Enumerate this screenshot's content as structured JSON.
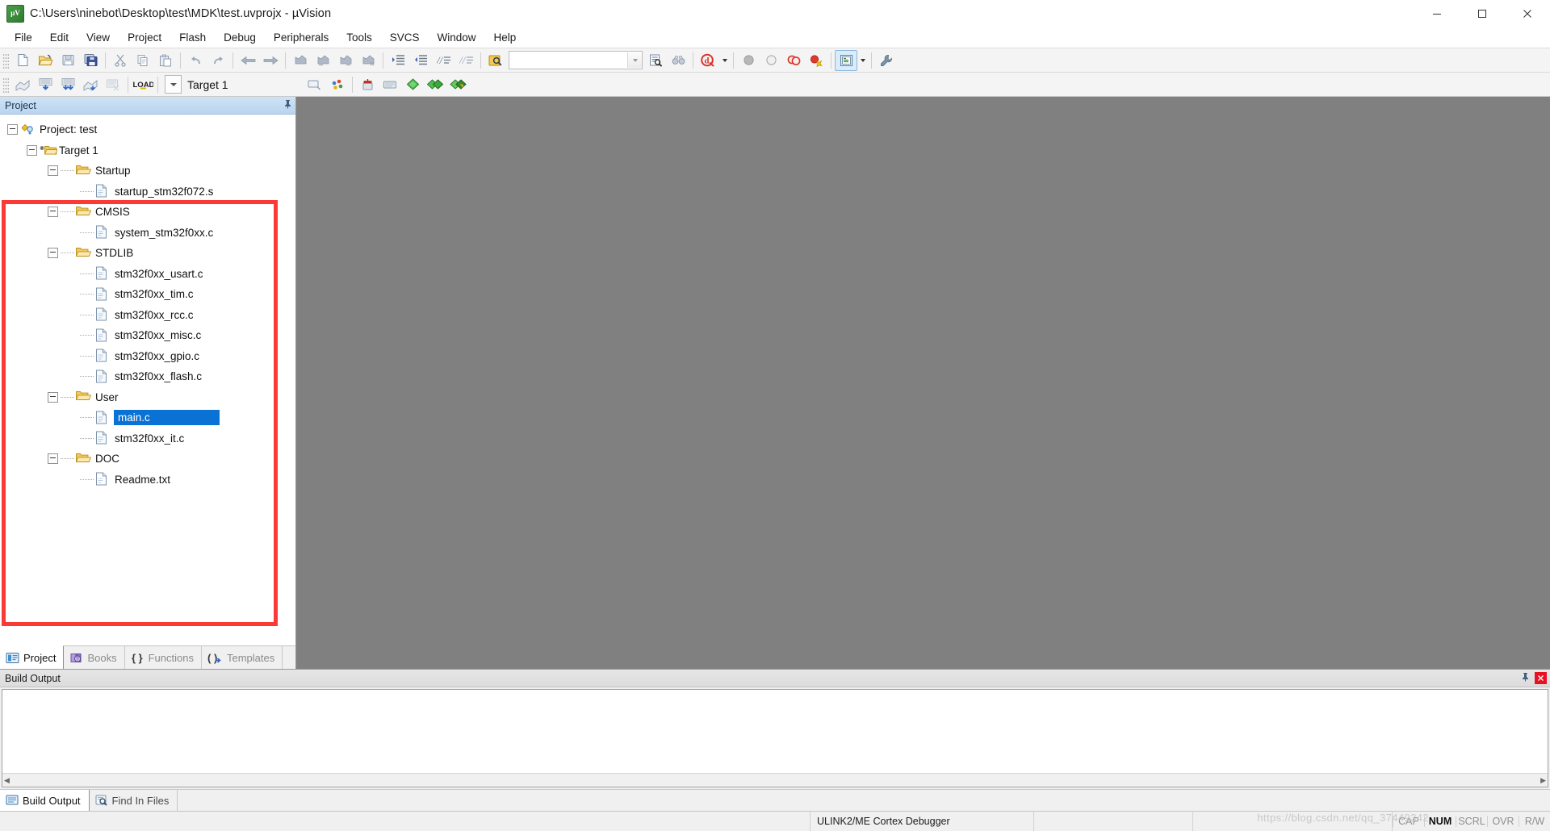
{
  "window": {
    "title": "C:\\Users\\ninebot\\Desktop\\test\\MDK\\test.uvprojx - µVision",
    "app_icon": "uvision-logo-icon",
    "minimize": "–",
    "maximize": "□",
    "close": "✕"
  },
  "menu": {
    "items": [
      {
        "label": "File"
      },
      {
        "label": "Edit"
      },
      {
        "label": "View"
      },
      {
        "label": "Project"
      },
      {
        "label": "Flash"
      },
      {
        "label": "Debug"
      },
      {
        "label": "Peripherals"
      },
      {
        "label": "Tools"
      },
      {
        "label": "SVCS"
      },
      {
        "label": "Window"
      },
      {
        "label": "Help"
      }
    ]
  },
  "toolbar_main": {
    "buttons": [
      {
        "name": "new-file-icon",
        "tooltip": "New"
      },
      {
        "name": "open-file-icon",
        "tooltip": "Open"
      },
      {
        "name": "save-icon",
        "tooltip": "Save"
      },
      {
        "name": "save-all-icon",
        "tooltip": "Save All"
      },
      {
        "name": "cut-icon",
        "tooltip": "Cut"
      },
      {
        "name": "copy-icon",
        "tooltip": "Copy"
      },
      {
        "name": "paste-icon",
        "tooltip": "Paste"
      },
      {
        "name": "undo-icon",
        "tooltip": "Undo"
      },
      {
        "name": "redo-icon",
        "tooltip": "Redo"
      },
      {
        "name": "navigate-backward-icon",
        "tooltip": "Back"
      },
      {
        "name": "navigate-forward-icon",
        "tooltip": "Forward"
      },
      {
        "name": "bookmark-toggle-icon",
        "tooltip": "Insert/Remove Bookmark"
      },
      {
        "name": "bookmark-prev-icon",
        "tooltip": "Previous Bookmark"
      },
      {
        "name": "bookmark-next-icon",
        "tooltip": "Next Bookmark"
      },
      {
        "name": "bookmark-clear-icon",
        "tooltip": "Clear All Bookmarks"
      },
      {
        "name": "indent-icon",
        "tooltip": "Indent Selection"
      },
      {
        "name": "outdent-icon",
        "tooltip": "Outdent Selection"
      },
      {
        "name": "comment-icon",
        "tooltip": "Comment Selection"
      },
      {
        "name": "uncomment-icon",
        "tooltip": "Uncomment Selection"
      },
      {
        "name": "find-in-files-icon",
        "tooltip": "Find in Files"
      }
    ],
    "search_box": {
      "value": "",
      "placeholder": ""
    },
    "after_search": [
      {
        "name": "text-search-icon",
        "tooltip": "Find"
      },
      {
        "name": "binoculars-icon",
        "tooltip": "Find Next"
      },
      {
        "name": "debug-session-icon",
        "tooltip": "Start/Stop Debug Session"
      },
      {
        "name": "breakpoint-disabled-icon",
        "tooltip": "Insert/Remove Breakpoint"
      },
      {
        "name": "breakpoint-off-icon",
        "tooltip": "Enable/Disable Breakpoint"
      },
      {
        "name": "breakpoints-disable-all-icon",
        "tooltip": "Disable All Breakpoints"
      },
      {
        "name": "breakpoints-kill-all-icon",
        "tooltip": "Kill All Breakpoints"
      },
      {
        "name": "manage-windows-icon",
        "tooltip": "Manage Component Windows"
      },
      {
        "name": "configure-icon",
        "tooltip": "Configuration Wizard"
      }
    ]
  },
  "toolbar_build": {
    "buttons": [
      {
        "name": "translate-icon",
        "tooltip": "Translate current file"
      },
      {
        "name": "build-icon",
        "tooltip": "Build"
      },
      {
        "name": "rebuild-icon",
        "tooltip": "Rebuild"
      },
      {
        "name": "batch-build-icon",
        "tooltip": "Batch Build"
      },
      {
        "name": "stop-build-icon",
        "tooltip": "Stop Build"
      },
      {
        "name": "download-icon",
        "tooltip": "Download",
        "label": "LOAD"
      }
    ],
    "target_label": "Target 1",
    "after_target": [
      {
        "name": "target-options-icon",
        "tooltip": "Options for Target"
      },
      {
        "name": "manage-runtime-icon",
        "tooltip": "Manage Run-Time Environment"
      },
      {
        "name": "package-installer-icon",
        "tooltip": "Pack Installer"
      },
      {
        "name": "multi-project-icon",
        "tooltip": "Manage Multi-Project"
      },
      {
        "name": "project-items-icon",
        "tooltip": "Manage Project Items"
      },
      {
        "name": "components-icon",
        "tooltip": "Components, Environment, Books"
      }
    ]
  },
  "project_pane": {
    "header_title": "Project",
    "pin_icon": "pin-icon",
    "tree": [
      {
        "label": "Project: test",
        "depth": 0,
        "icon": "project-icon",
        "twist": "minus",
        "selected": false
      },
      {
        "label": "Target 1",
        "depth": 1,
        "icon": "target-icon",
        "twist": "minus",
        "selected": false
      },
      {
        "label": "Startup",
        "depth": 2,
        "icon": "folder-icon",
        "twist": "minus",
        "selected": false
      },
      {
        "label": "startup_stm32f072.s",
        "depth": 3,
        "icon": "file-icon",
        "twist": "none",
        "selected": false
      },
      {
        "label": "CMSIS",
        "depth": 2,
        "icon": "folder-icon",
        "twist": "minus",
        "selected": false
      },
      {
        "label": "system_stm32f0xx.c",
        "depth": 3,
        "icon": "file-icon",
        "twist": "none",
        "selected": false
      },
      {
        "label": "STDLIB",
        "depth": 2,
        "icon": "folder-icon",
        "twist": "minus",
        "selected": false
      },
      {
        "label": "stm32f0xx_usart.c",
        "depth": 3,
        "icon": "file-icon",
        "twist": "none",
        "selected": false
      },
      {
        "label": "stm32f0xx_tim.c",
        "depth": 3,
        "icon": "file-icon",
        "twist": "none",
        "selected": false
      },
      {
        "label": "stm32f0xx_rcc.c",
        "depth": 3,
        "icon": "file-icon",
        "twist": "none",
        "selected": false
      },
      {
        "label": "stm32f0xx_misc.c",
        "depth": 3,
        "icon": "file-icon",
        "twist": "none",
        "selected": false
      },
      {
        "label": "stm32f0xx_gpio.c",
        "depth": 3,
        "icon": "file-icon",
        "twist": "none",
        "selected": false
      },
      {
        "label": "stm32f0xx_flash.c",
        "depth": 3,
        "icon": "file-icon",
        "twist": "none",
        "selected": false
      },
      {
        "label": "User",
        "depth": 2,
        "icon": "folder-icon",
        "twist": "minus",
        "selected": false
      },
      {
        "label": "main.c",
        "depth": 3,
        "icon": "file-icon",
        "twist": "none",
        "selected": true
      },
      {
        "label": "stm32f0xx_it.c",
        "depth": 3,
        "icon": "file-icon",
        "twist": "none",
        "selected": false
      },
      {
        "label": "DOC",
        "depth": 2,
        "icon": "folder-icon",
        "twist": "minus",
        "selected": false
      },
      {
        "label": "Readme.txt",
        "depth": 3,
        "icon": "text-file-icon",
        "twist": "none",
        "selected": false
      }
    ],
    "tabs": [
      {
        "label": "Project",
        "icon": "project-tab-icon",
        "active": true
      },
      {
        "label": "Books",
        "icon": "books-tab-icon",
        "active": false
      },
      {
        "label": "Functions",
        "icon": "functions-tab-icon",
        "active": false
      },
      {
        "label": "Templates",
        "icon": "templates-tab-icon",
        "active": false
      }
    ]
  },
  "build_output": {
    "header_title": "Build Output",
    "pin_icon": "pin-icon",
    "close_icon": "close-icon",
    "content": "",
    "tabs": [
      {
        "label": "Build Output",
        "icon": "build-output-tab-icon",
        "active": true
      },
      {
        "label": "Find In Files",
        "icon": "find-in-files-tab-icon",
        "active": false
      }
    ]
  },
  "status_bar": {
    "left": "",
    "debugger": "ULINK2/ME Cortex Debugger",
    "indicators": [
      {
        "label": "CAP",
        "on": false
      },
      {
        "label": "NUM",
        "on": true
      },
      {
        "label": "SCRL",
        "on": false
      },
      {
        "label": "OVR",
        "on": false
      },
      {
        "label": "R/W",
        "on": false
      }
    ],
    "watermark": "https://blog.csdn.net/qq_37449342"
  },
  "colors": {
    "selection": "#0a72d4",
    "annotation": "#fb3a35",
    "editor_background": "#808080",
    "pane_header": "#bcd6ef"
  }
}
